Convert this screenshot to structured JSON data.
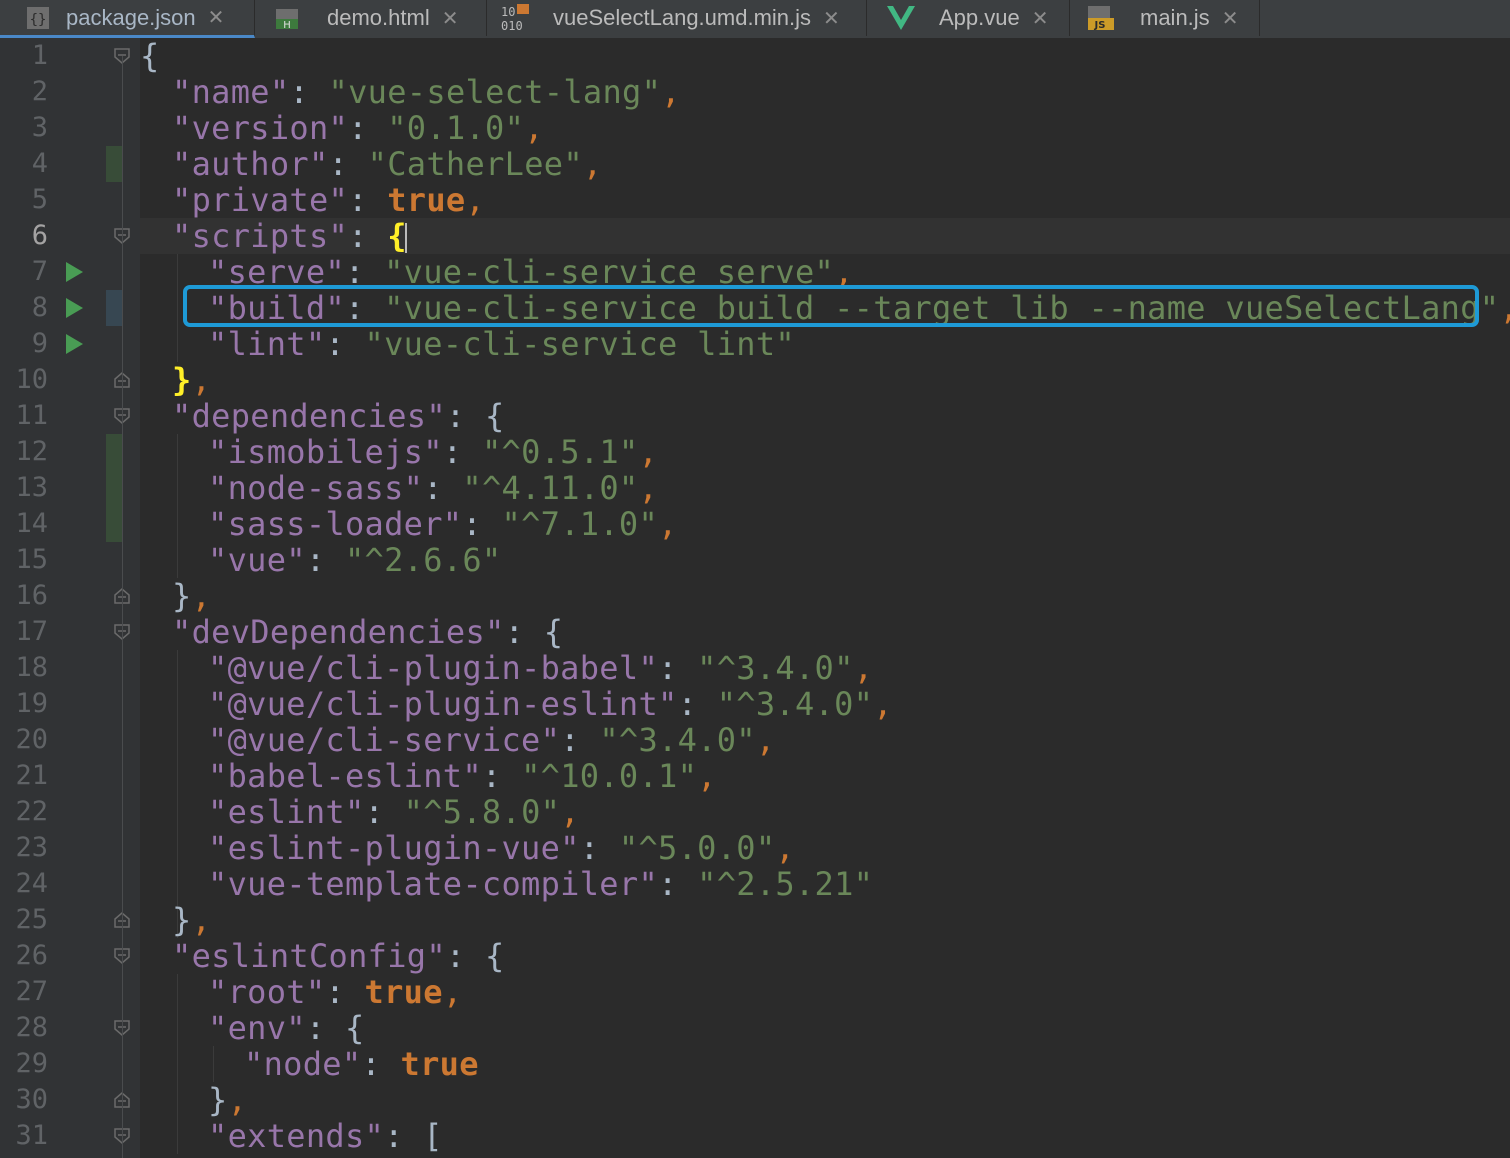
{
  "tabs": [
    {
      "label": "package.json",
      "icon": "json-file-icon",
      "active": true
    },
    {
      "label": "demo.html",
      "icon": "html-file-icon",
      "active": false
    },
    {
      "label": "vueSelectLang.umd.min.js",
      "icon": "binary-js-file-icon",
      "active": false
    },
    {
      "label": "App.vue",
      "icon": "vue-file-icon",
      "active": false
    },
    {
      "label": "main.js",
      "icon": "js-file-icon",
      "active": false
    }
  ],
  "editor": {
    "current_line": 6,
    "line_numbers": [
      "1",
      "2",
      "3",
      "4",
      "5",
      "6",
      "7",
      "8",
      "9",
      "10",
      "11",
      "12",
      "13",
      "14",
      "15",
      "16",
      "17",
      "18",
      "19",
      "20",
      "21",
      "22",
      "23",
      "24",
      "25",
      "26",
      "27",
      "28",
      "29",
      "30",
      "31"
    ],
    "lines": [
      {
        "indent": 0,
        "tokens": [
          {
            "t": "b",
            "v": "{"
          }
        ]
      },
      {
        "indent": 1,
        "tokens": [
          {
            "t": "k",
            "v": "\"name\""
          },
          {
            "t": "b",
            "v": ": "
          },
          {
            "t": "s",
            "v": "\"vue-select-lang\""
          },
          {
            "t": "p",
            "v": ","
          }
        ]
      },
      {
        "indent": 1,
        "tokens": [
          {
            "t": "k",
            "v": "\"version\""
          },
          {
            "t": "b",
            "v": ": "
          },
          {
            "t": "s",
            "v": "\"0.1.0\""
          },
          {
            "t": "p",
            "v": ","
          }
        ]
      },
      {
        "indent": 1,
        "tokens": [
          {
            "t": "k",
            "v": "\"author\""
          },
          {
            "t": "b",
            "v": ": "
          },
          {
            "t": "s",
            "v": "\"CatherLee\""
          },
          {
            "t": "p",
            "v": ","
          }
        ]
      },
      {
        "indent": 1,
        "tokens": [
          {
            "t": "k",
            "v": "\"private\""
          },
          {
            "t": "b",
            "v": ": "
          },
          {
            "t": "kw",
            "v": "true"
          },
          {
            "t": "p",
            "v": ","
          }
        ]
      },
      {
        "indent": 1,
        "tokens": [
          {
            "t": "k",
            "v": "\"scripts\""
          },
          {
            "t": "b",
            "v": ": "
          },
          {
            "t": "bm",
            "v": "{"
          }
        ]
      },
      {
        "indent": 2,
        "tokens": [
          {
            "t": "k",
            "v": "\"serve\""
          },
          {
            "t": "b",
            "v": ": "
          },
          {
            "t": "s",
            "v": "\"vue-cli-service serve\""
          },
          {
            "t": "p",
            "v": ","
          }
        ]
      },
      {
        "indent": 2,
        "tokens": [
          {
            "t": "k",
            "v": "\"build\""
          },
          {
            "t": "b",
            "v": ": "
          },
          {
            "t": "s",
            "v": "\"vue-cli-service build --target lib --name vueSelectLang\""
          },
          {
            "t": "p",
            "v": ","
          }
        ]
      },
      {
        "indent": 2,
        "tokens": [
          {
            "t": "k",
            "v": "\"lint\""
          },
          {
            "t": "b",
            "v": ": "
          },
          {
            "t": "s",
            "v": "\"vue-cli-service lint\""
          }
        ]
      },
      {
        "indent": 1,
        "tokens": [
          {
            "t": "bm",
            "v": "}"
          },
          {
            "t": "p",
            "v": ","
          }
        ]
      },
      {
        "indent": 1,
        "tokens": [
          {
            "t": "k",
            "v": "\"dependencies\""
          },
          {
            "t": "b",
            "v": ": {"
          }
        ]
      },
      {
        "indent": 2,
        "tokens": [
          {
            "t": "k",
            "v": "\"ismobilejs\""
          },
          {
            "t": "b",
            "v": ": "
          },
          {
            "t": "s",
            "v": "\"^0.5.1\""
          },
          {
            "t": "p",
            "v": ","
          }
        ]
      },
      {
        "indent": 2,
        "tokens": [
          {
            "t": "k",
            "v": "\"node-sass\""
          },
          {
            "t": "b",
            "v": ": "
          },
          {
            "t": "s",
            "v": "\"^4.11.0\""
          },
          {
            "t": "p",
            "v": ","
          }
        ]
      },
      {
        "indent": 2,
        "tokens": [
          {
            "t": "k",
            "v": "\"sass-loader\""
          },
          {
            "t": "b",
            "v": ": "
          },
          {
            "t": "s",
            "v": "\"^7.1.0\""
          },
          {
            "t": "p",
            "v": ","
          }
        ]
      },
      {
        "indent": 2,
        "tokens": [
          {
            "t": "k",
            "v": "\"vue\""
          },
          {
            "t": "b",
            "v": ": "
          },
          {
            "t": "s",
            "v": "\"^2.6.6\""
          }
        ]
      },
      {
        "indent": 1,
        "tokens": [
          {
            "t": "b",
            "v": "}"
          },
          {
            "t": "p",
            "v": ","
          }
        ]
      },
      {
        "indent": 1,
        "tokens": [
          {
            "t": "k",
            "v": "\"devDependencies\""
          },
          {
            "t": "b",
            "v": ": {"
          }
        ]
      },
      {
        "indent": 2,
        "tokens": [
          {
            "t": "k",
            "v": "\"@vue/cli-plugin-babel\""
          },
          {
            "t": "b",
            "v": ": "
          },
          {
            "t": "s",
            "v": "\"^3.4.0\""
          },
          {
            "t": "p",
            "v": ","
          }
        ]
      },
      {
        "indent": 2,
        "tokens": [
          {
            "t": "k",
            "v": "\"@vue/cli-plugin-eslint\""
          },
          {
            "t": "b",
            "v": ": "
          },
          {
            "t": "s",
            "v": "\"^3.4.0\""
          },
          {
            "t": "p",
            "v": ","
          }
        ]
      },
      {
        "indent": 2,
        "tokens": [
          {
            "t": "k",
            "v": "\"@vue/cli-service\""
          },
          {
            "t": "b",
            "v": ": "
          },
          {
            "t": "s",
            "v": "\"^3.4.0\""
          },
          {
            "t": "p",
            "v": ","
          }
        ]
      },
      {
        "indent": 2,
        "tokens": [
          {
            "t": "k",
            "v": "\"babel-eslint\""
          },
          {
            "t": "b",
            "v": ": "
          },
          {
            "t": "s",
            "v": "\"^10.0.1\""
          },
          {
            "t": "p",
            "v": ","
          }
        ]
      },
      {
        "indent": 2,
        "tokens": [
          {
            "t": "k",
            "v": "\"eslint\""
          },
          {
            "t": "b",
            "v": ": "
          },
          {
            "t": "s",
            "v": "\"^5.8.0\""
          },
          {
            "t": "p",
            "v": ","
          }
        ]
      },
      {
        "indent": 2,
        "tokens": [
          {
            "t": "k",
            "v": "\"eslint-plugin-vue\""
          },
          {
            "t": "b",
            "v": ": "
          },
          {
            "t": "s",
            "v": "\"^5.0.0\""
          },
          {
            "t": "p",
            "v": ","
          }
        ]
      },
      {
        "indent": 2,
        "tokens": [
          {
            "t": "k",
            "v": "\"vue-template-compiler\""
          },
          {
            "t": "b",
            "v": ": "
          },
          {
            "t": "s",
            "v": "\"^2.5.21\""
          }
        ]
      },
      {
        "indent": 1,
        "tokens": [
          {
            "t": "b",
            "v": "}"
          },
          {
            "t": "p",
            "v": ","
          }
        ]
      },
      {
        "indent": 1,
        "tokens": [
          {
            "t": "k",
            "v": "\"eslintConfig\""
          },
          {
            "t": "b",
            "v": ": {"
          }
        ]
      },
      {
        "indent": 2,
        "tokens": [
          {
            "t": "k",
            "v": "\"root\""
          },
          {
            "t": "b",
            "v": ": "
          },
          {
            "t": "kw",
            "v": "true"
          },
          {
            "t": "p",
            "v": ","
          }
        ]
      },
      {
        "indent": 2,
        "tokens": [
          {
            "t": "k",
            "v": "\"env\""
          },
          {
            "t": "b",
            "v": ": {"
          }
        ]
      },
      {
        "indent": 3,
        "tokens": [
          {
            "t": "k",
            "v": "\"node\""
          },
          {
            "t": "b",
            "v": ": "
          },
          {
            "t": "kw",
            "v": "true"
          }
        ]
      },
      {
        "indent": 2,
        "tokens": [
          {
            "t": "b",
            "v": "}"
          },
          {
            "t": "p",
            "v": ","
          }
        ]
      },
      {
        "indent": 2,
        "tokens": [
          {
            "t": "k",
            "v": "\"extends\""
          },
          {
            "t": "b",
            "v": ": ["
          }
        ]
      }
    ]
  },
  "colors": {
    "key": "#9876aa",
    "string": "#6a8759",
    "keyword": "#cc7832",
    "highlight_box": "#1e9ad6",
    "run_marker": "#499c54"
  }
}
